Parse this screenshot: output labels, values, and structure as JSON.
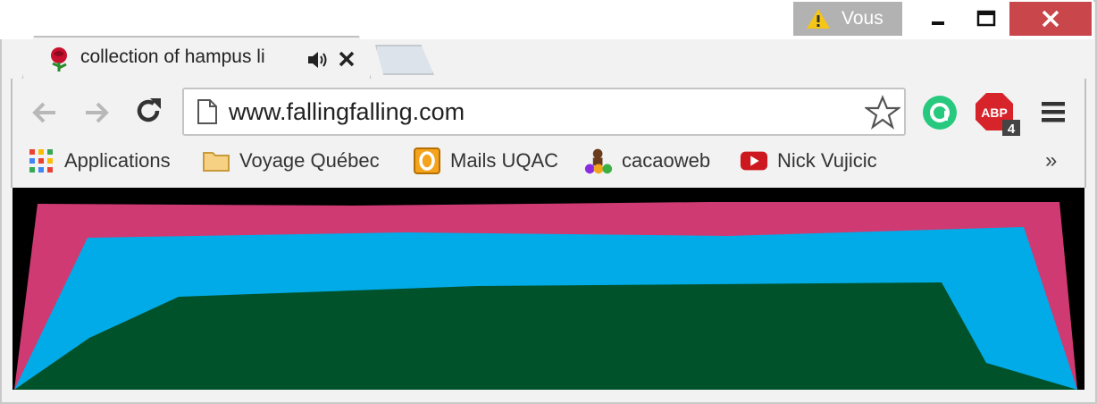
{
  "window": {
    "profile_name": "Vous"
  },
  "tab": {
    "title": "collection of hampus li",
    "icon": "rose-favicon",
    "audio_icon": "speaker-icon",
    "close_icon": "close-icon"
  },
  "toolbar": {
    "url": "www.fallingfalling.com",
    "extensions": [
      {
        "name": "grammarly-extension-icon",
        "color": "#27c97f"
      },
      {
        "name": "adblock-plus-extension-icon",
        "label": "ABP",
        "badge": "4",
        "color": "#d7232a"
      }
    ]
  },
  "bookmarks": [
    {
      "label": "Applications",
      "icon": "apps-grid-icon"
    },
    {
      "label": "Voyage Québec",
      "icon": "folder-icon"
    },
    {
      "label": "Mails UQAC",
      "icon": "outlook-icon"
    },
    {
      "label": "cacaoweb",
      "icon": "cacaoweb-icon"
    },
    {
      "label": "Nick Vujicic",
      "icon": "youtube-icon"
    }
  ],
  "bookmarks_overflow": "»",
  "page": {
    "colors": {
      "background": "#000000",
      "pink": "#d03a72",
      "blue": "#00abe8",
      "green": "#00522a"
    }
  }
}
